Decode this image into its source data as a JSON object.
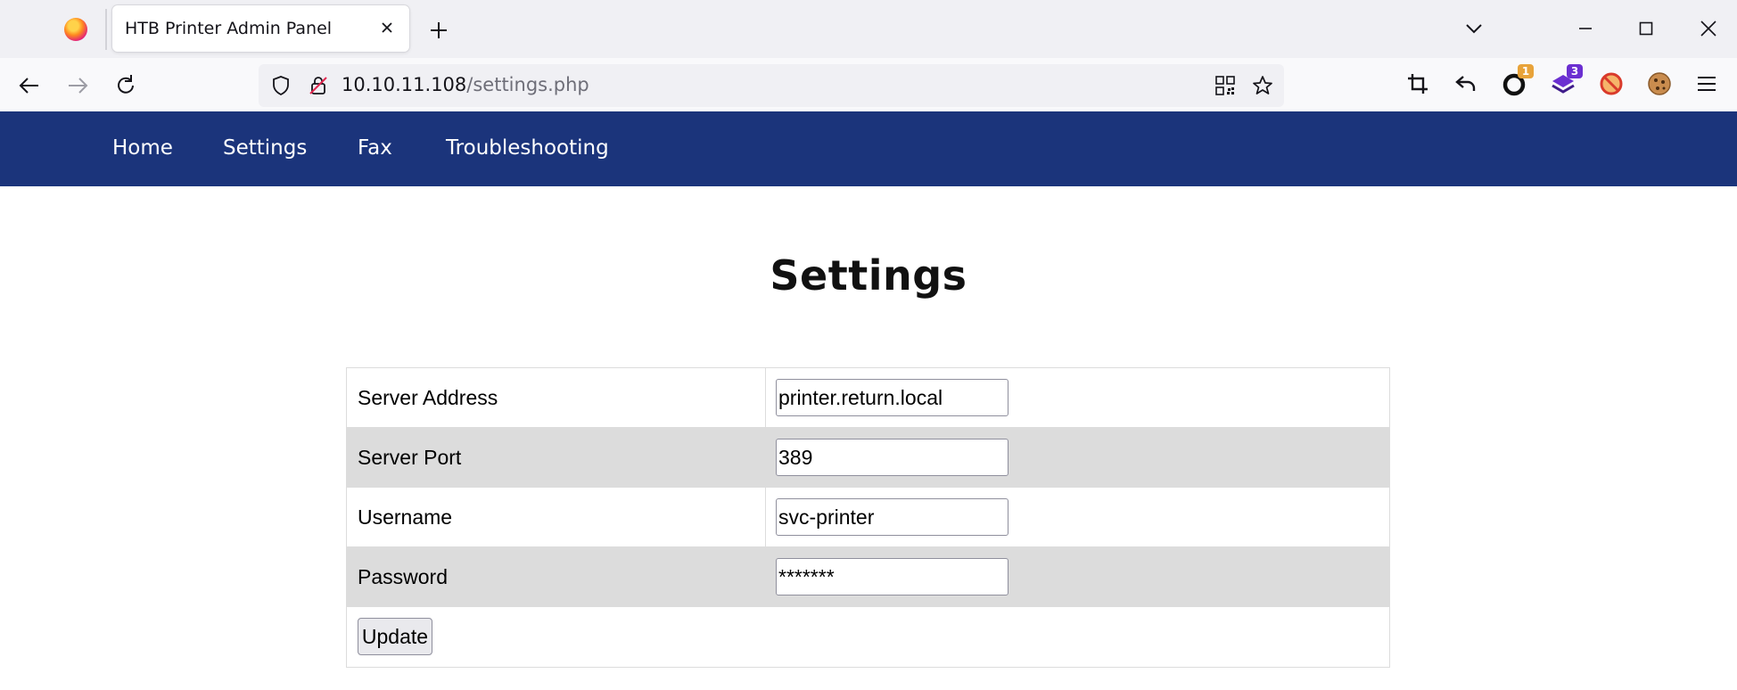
{
  "browser": {
    "tab_title": "HTB Printer Admin Panel",
    "url_host": "10.10.11.108",
    "url_path": "/settings.php",
    "extensions": [
      {
        "icon": "crop-icon",
        "badge": ""
      },
      {
        "icon": "undo-arrow-icon",
        "badge": ""
      },
      {
        "icon": "extension-ring-icon",
        "badge": "1"
      },
      {
        "icon": "extension-stack-icon",
        "badge": "3"
      },
      {
        "icon": "blocked-icon",
        "badge": ""
      },
      {
        "icon": "cookie-icon",
        "badge": ""
      }
    ]
  },
  "site_nav": {
    "items": [
      "Home",
      "Settings",
      "Fax",
      "Troubleshooting"
    ]
  },
  "page": {
    "title": "Settings"
  },
  "form": {
    "rows": [
      {
        "label": "Server Address",
        "value": "printer.return.local",
        "type": "text"
      },
      {
        "label": "Server Port",
        "value": "389",
        "type": "text"
      },
      {
        "label": "Username",
        "value": "svc-printer",
        "type": "text"
      },
      {
        "label": "Password",
        "value": "*******",
        "type": "password"
      }
    ],
    "submit_label": "Update"
  },
  "colors": {
    "nav_bg": "#1b347b",
    "row_alt_bg": "#dcdcdc",
    "badge_orange": "#e8a33a",
    "badge_purple": "#6b2fd1"
  }
}
